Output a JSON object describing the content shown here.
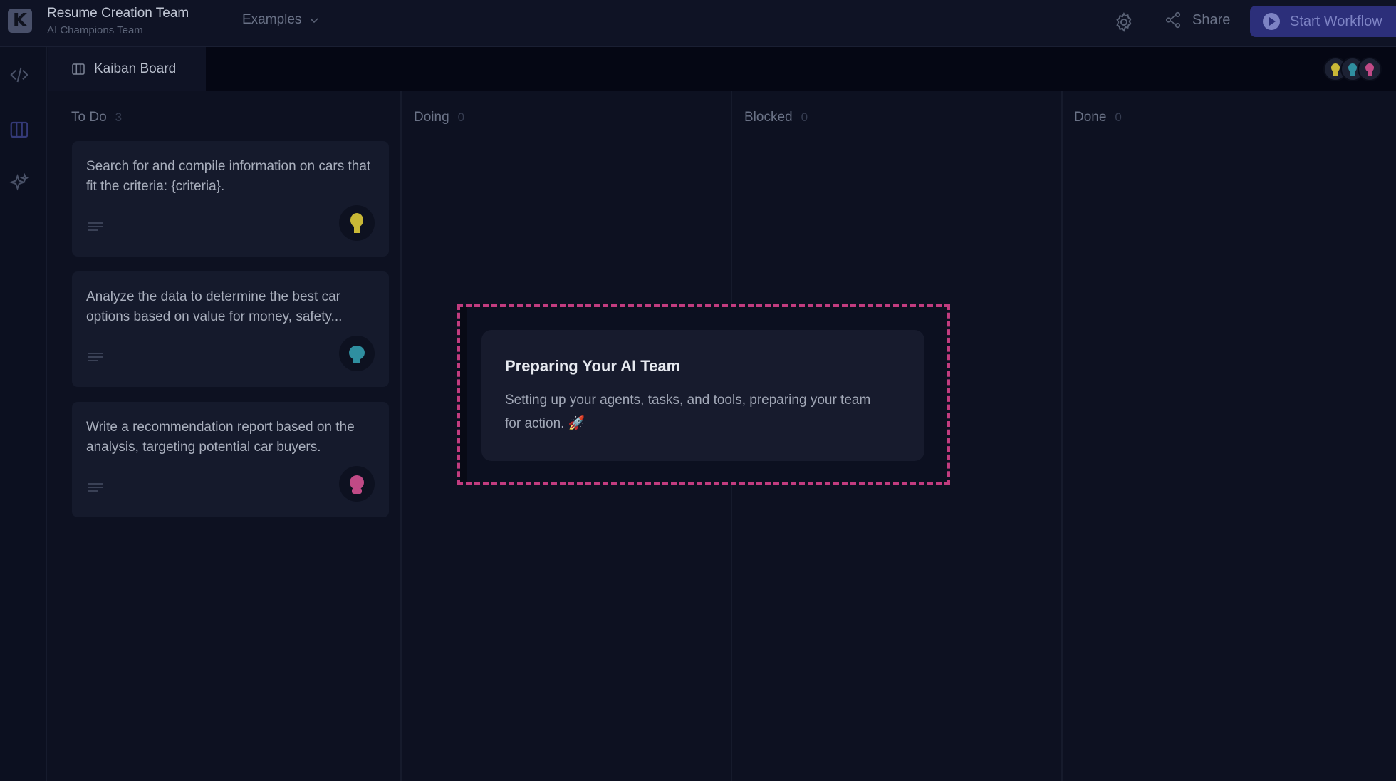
{
  "app": {
    "logo_letter": "K",
    "team_title": "Resume Creation Team",
    "team_subtitle": "AI Champions Team",
    "examples_label": "Examples",
    "share_label": "Share",
    "start_workflow_label": "Start Workflow",
    "accent_color": "#2c2f7a"
  },
  "rail": {
    "items": [
      {
        "icon": "code-icon"
      },
      {
        "icon": "kanban-icon"
      },
      {
        "icon": "sparkles-icon"
      }
    ]
  },
  "tabs": {
    "active_label": "Kaiban Board"
  },
  "columns": [
    {
      "title": "To Do",
      "count": "3"
    },
    {
      "title": "Doing",
      "count": "0"
    },
    {
      "title": "Blocked",
      "count": "0"
    },
    {
      "title": "Done",
      "count": "0"
    }
  ],
  "cards": [
    {
      "text": "Search for and compile information on cars that fit the criteria: {criteria}.",
      "agent_color": "#c9b836"
    },
    {
      "text": "Analyze the data to determine the best car options based on value for money, safety...",
      "agent_color": "#2f8fa0"
    },
    {
      "text": "Write a recommendation report based on the analysis, targeting potential car buyers.",
      "agent_color": "#c04a86"
    }
  ],
  "modal": {
    "title": "Preparing Your AI Team",
    "body": "Setting up your agents, tasks, and tools, preparing your team for action. 🚀",
    "highlight_color": "#c23c7f"
  }
}
